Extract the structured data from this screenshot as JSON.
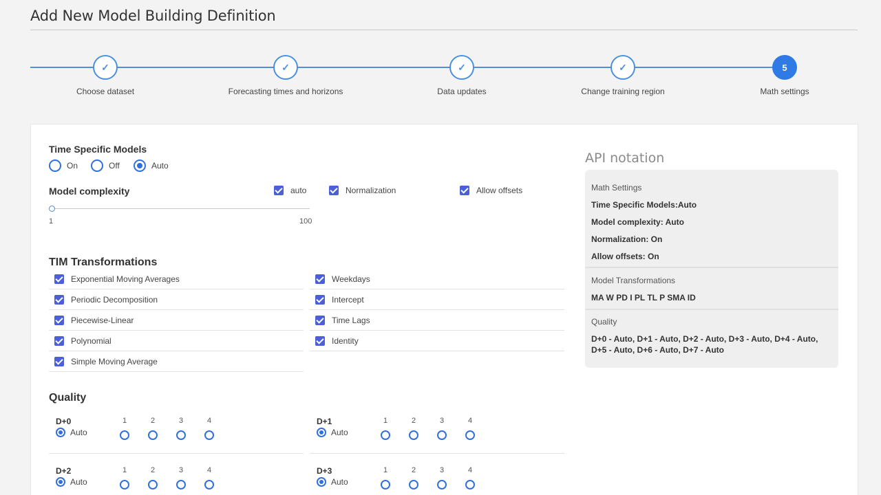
{
  "page": {
    "title": "Add New Model Building Definition"
  },
  "stepper": {
    "steps": [
      {
        "label": "Choose dataset",
        "state": "done"
      },
      {
        "label": "Forecasting times and horizons",
        "state": "done"
      },
      {
        "label": "Data updates",
        "state": "done"
      },
      {
        "label": "Change training region",
        "state": "done"
      },
      {
        "label": "Math settings",
        "state": "active",
        "number": "5"
      }
    ],
    "check_glyph": "✓"
  },
  "form": {
    "time_specific": {
      "label": "Time Specific Models",
      "options": [
        "On",
        "Off",
        "Auto"
      ],
      "selected": "Auto"
    },
    "model_complexity": {
      "label": "Model complexity",
      "min_label": "1",
      "max_label": "100",
      "value": 1
    },
    "checks": {
      "auto": "auto",
      "normalization": "Normalization",
      "allow_offsets": "Allow offsets"
    },
    "tim": {
      "title": "TIM Transformations",
      "left": [
        "Exponential Moving Averages",
        "Periodic Decomposition",
        "Piecewise-Linear",
        "Polynomial",
        "Simple Moving Average"
      ],
      "right": [
        "Weekdays",
        "Intercept",
        "Time Lags",
        "Identity"
      ]
    },
    "quality": {
      "title": "Quality",
      "auto_label": "Auto",
      "levels": [
        "1",
        "2",
        "3",
        "4"
      ],
      "horizons": [
        "D+0",
        "D+1",
        "D+2",
        "D+3"
      ]
    }
  },
  "api": {
    "title": "API notation",
    "math_head": "Math Settings",
    "lines": [
      "Time Specific Models:Auto",
      "Model complexity: Auto",
      "Normalization: On",
      "Allow offsets: On"
    ],
    "trans_head": "Model Transformations",
    "trans_value": "MA W PD I PL TL P SMA ID",
    "quality_head": "Quality",
    "quality_value": "D+0 - Auto, D+1 - Auto, D+2 - Auto, D+3 - Auto, D+4 - Auto, D+5 - Auto, D+6 - Auto, D+7 - Auto"
  },
  "colors": {
    "accent": "#2f7ae5",
    "checkbox": "#4a5fd8",
    "radio": "#2f6fde"
  }
}
